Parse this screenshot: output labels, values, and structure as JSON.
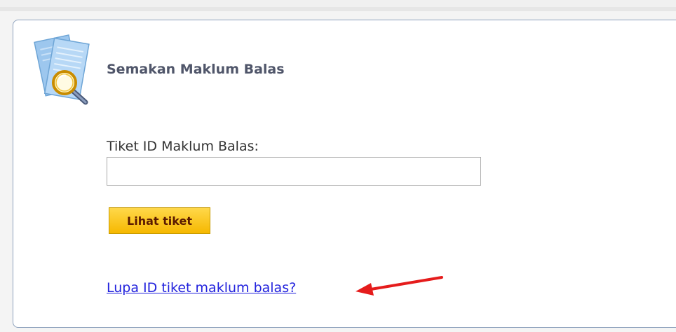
{
  "header": {
    "title": "Semakan Maklum Balas",
    "icon": "document-search-icon"
  },
  "form": {
    "ticket_label": "Tiket ID Maklum Balas:",
    "ticket_value": "",
    "ticket_placeholder": "",
    "submit_label": "Lihat tiket"
  },
  "links": {
    "forgot_label": "Lupa ID tiket maklum balas?"
  },
  "annotation": {
    "arrow_color": "#e51c1c"
  },
  "colors": {
    "panel_border": "#8ea2bd",
    "title_text": "#50566a",
    "button_fill": "#f6b800",
    "link_text": "#2222dd"
  }
}
